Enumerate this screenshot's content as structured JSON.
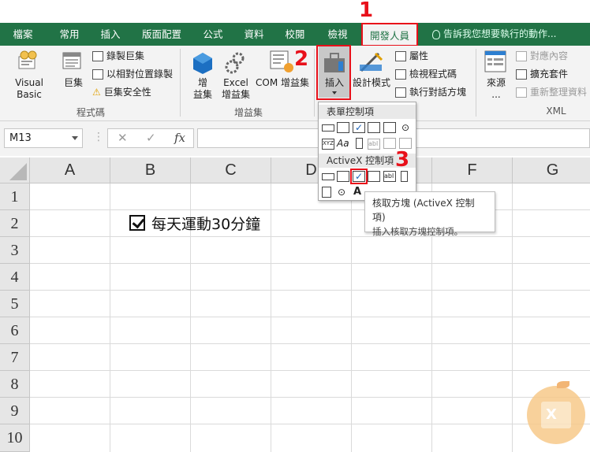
{
  "tabs": [
    "檔案",
    "常用",
    "插入",
    "版面配置",
    "公式",
    "資料",
    "校閱",
    "檢視",
    "開發人員"
  ],
  "tell_me": "告訴我您想要執行的動作...",
  "ribbon": {
    "code": {
      "visual_basic": "Visual Basic",
      "macros": "巨集",
      "record_macro": "錄製巨集",
      "relative_ref": "以相對位置錄製",
      "macro_security": "巨集安全性",
      "label": "程式碼"
    },
    "addins": {
      "addins": "增\n益集",
      "excel_addins": "Excel\n增益集",
      "com_addins": "COM 增益集",
      "label": "增益集"
    },
    "controls": {
      "insert": "插入",
      "design_mode": "設計模式",
      "properties": "屬性",
      "view_code": "檢視程式碼",
      "run_dialog": "執行對話方塊"
    },
    "xml": {
      "source": "來源",
      "map_props": "對應內容",
      "expansion_packs": "擴充套件",
      "refresh_data": "重新整理資料",
      "label": "XML"
    }
  },
  "annotations": [
    "1",
    "2",
    "3"
  ],
  "formula_bar": {
    "name_box": "M13",
    "cancel": "✕",
    "enter": "✓",
    "fx": "fx"
  },
  "columns": [
    "A",
    "B",
    "C",
    "D",
    "E",
    "F",
    "G"
  ],
  "rows": [
    "1",
    "2",
    "3",
    "4",
    "5",
    "6",
    "7",
    "8",
    "9",
    "10"
  ],
  "cell_content": {
    "checkbox_label": "每天運動30分鐘",
    "checked": true
  },
  "dropdown": {
    "form_controls": "表單控制項",
    "activex_controls": "ActiveX 控制項"
  },
  "tooltip": {
    "title": "核取方塊 (ActiveX 控制項)",
    "desc": "插入核取方塊控制項。"
  }
}
